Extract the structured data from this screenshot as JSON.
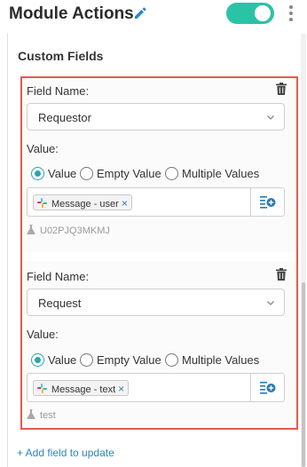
{
  "header": {
    "title": "Module Actions",
    "toggle_on": true,
    "toggle_color": "#2bc3a6",
    "edit_icon": "pencil-icon",
    "menu_icon": "kebab-menu-icon"
  },
  "section": {
    "title": "Custom Fields"
  },
  "highlight_color": "#e25c4b",
  "fields": [
    {
      "name_label": "Field Name:",
      "name_value": "Requestor",
      "value_label": "Value:",
      "radio_options": [
        "Value",
        "Empty Value",
        "Multiple Values"
      ],
      "radio_selected": "Value",
      "chip_label": "Message - user",
      "chip_remove": "×",
      "example_value": "U02PJQ3MKMJ"
    },
    {
      "name_label": "Field Name:",
      "name_value": "Request",
      "value_label": "Value:",
      "radio_options": [
        "Value",
        "Empty Value",
        "Multiple Values"
      ],
      "radio_selected": "Value",
      "chip_label": "Message - text",
      "chip_remove": "×",
      "example_value": "test"
    }
  ],
  "add_field_label": "+ Add field to update"
}
